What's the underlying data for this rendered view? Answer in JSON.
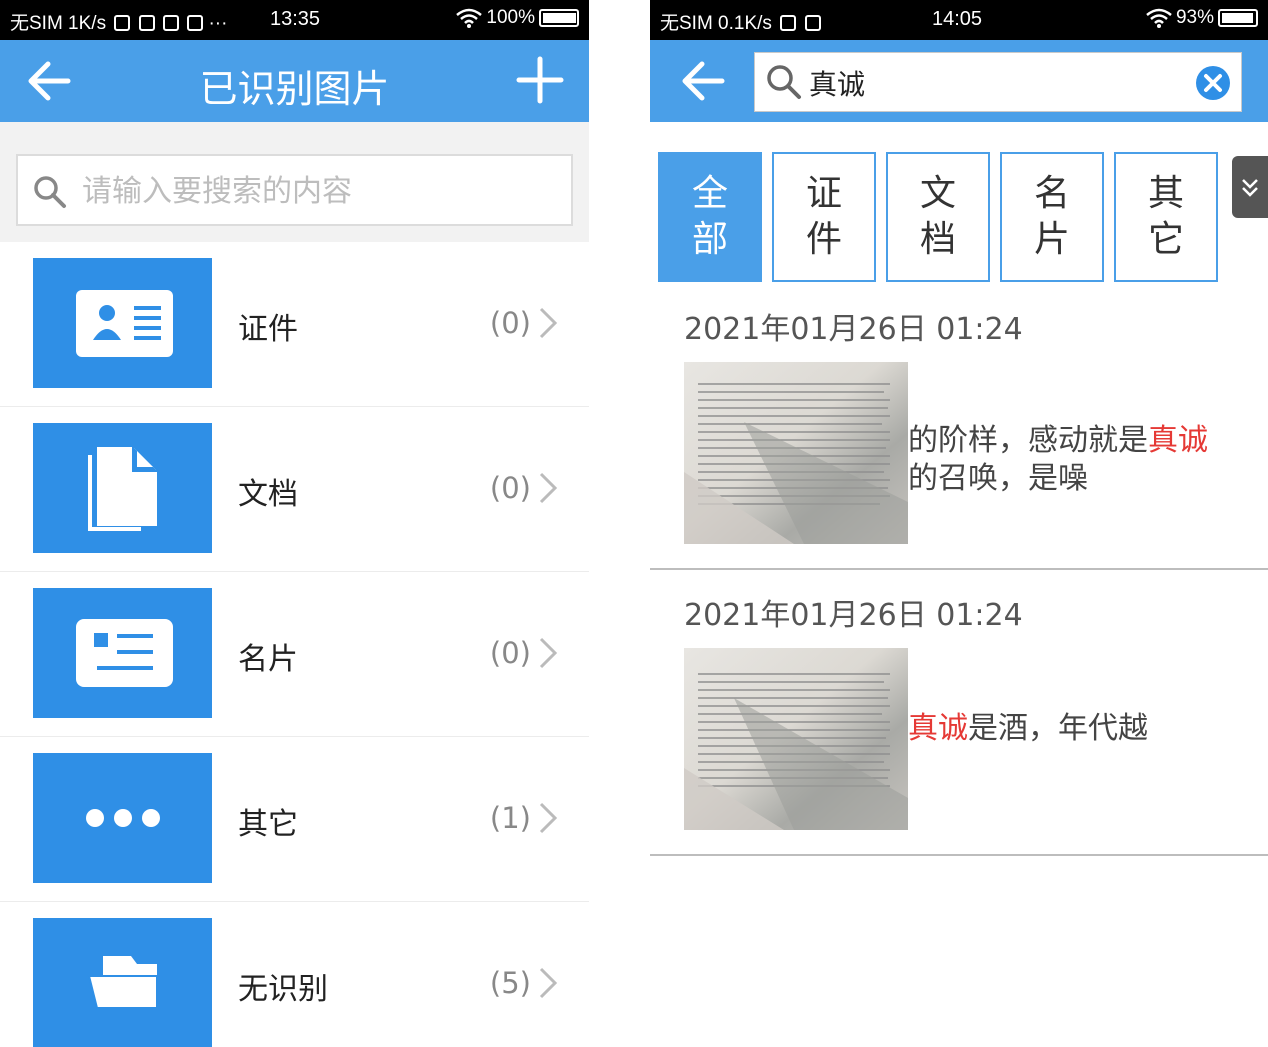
{
  "left": {
    "statusbar": {
      "carrier": "无SIM 1K/s",
      "extra": "···",
      "time": "13:35",
      "battery": "100%",
      "battery_level": 1.0
    },
    "title": "已识别图片",
    "back_icon": "arrow-left-icon",
    "add_icon": "plus-icon",
    "search": {
      "placeholder": "请输入要搜索的内容",
      "value": ""
    },
    "categories": [
      {
        "label": "证件",
        "count": "(0)",
        "icon": "id-card-icon"
      },
      {
        "label": "文档",
        "count": "(0)",
        "icon": "document-icon"
      },
      {
        "label": "名片",
        "count": "(0)",
        "icon": "business-card-icon"
      },
      {
        "label": "其它",
        "count": "(1)",
        "icon": "more-dots-icon"
      },
      {
        "label": "无识别",
        "count": "(5)",
        "icon": "folder-icon"
      }
    ]
  },
  "right": {
    "statusbar": {
      "carrier": "无SIM 0.1K/s",
      "time": "14:05",
      "battery": "93%",
      "battery_level": 0.93
    },
    "search": {
      "value": "真诚"
    },
    "tabs": [
      {
        "label": "全部",
        "active": true
      },
      {
        "label": "证件",
        "active": false
      },
      {
        "label": "文档",
        "active": false
      },
      {
        "label": "名片",
        "active": false
      },
      {
        "label": "其它",
        "active": false
      }
    ],
    "results": [
      {
        "date": "2021年01月26日 01:24",
        "snippet_line1_before": "的阶样，感动就是",
        "snippet_line1_highlight": "真诚",
        "snippet_line2": "的召唤，是噪"
      },
      {
        "date": "2021年01月26日 01:24",
        "snippet_highlight": "真诚",
        "snippet_after": "是酒，年代越"
      }
    ]
  },
  "colors": {
    "primary": "#4a9fe8",
    "icon_bg": "#2f8fe6",
    "highlight": "#e53935",
    "statusbar": "#000000"
  }
}
